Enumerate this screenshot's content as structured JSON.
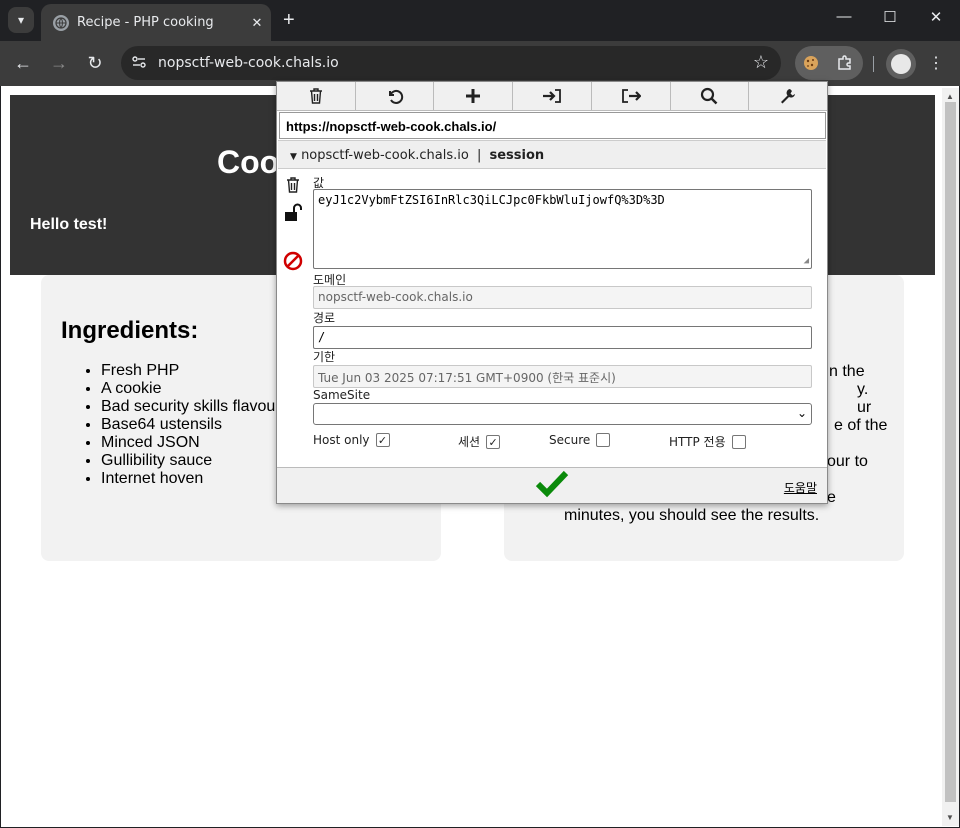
{
  "browser": {
    "tab_title": "Recipe - PHP cooking",
    "url": "nopsctf-web-cook.chals.io"
  },
  "page": {
    "hero_title": "Coo",
    "hello": "Hello test!",
    "ingredients_heading": "Ingredients:",
    "ingredients": [
      "Fresh PHP",
      "A cookie",
      "Bad security skills flavour",
      "Base64 ustensils",
      "Minced JSON",
      "Gullibility sauce",
      "Internet hoven"
    ],
    "right_fragments": [
      "n the",
      "y.",
      "ur",
      "e of the",
      "our to",
      "e",
      "minutes, you should see the results."
    ]
  },
  "cookie_editor": {
    "url": "https://nopsctf-web-cook.chals.io/",
    "domain_header": "nopsctf-web-cook.chals.io",
    "separator": "|",
    "cookie_name": "session",
    "value_label": "값",
    "value": "eyJ1c2VybmFtZSI6InRlc3QiLCJpc0FkbWluIjowfQ%3D%3D",
    "domain_label": "도메인",
    "domain": "nopsctf-web-cook.chals.io",
    "path_label": "경로",
    "path": "/",
    "expires_label": "기한",
    "expires": "Tue Jun 03 2025 07:17:51 GMT+0900 (한국 표준시)",
    "samesite_label": "SameSite",
    "samesite": "",
    "hostonly_label": "Host only",
    "session_label": "세션",
    "secure_label": "Secure",
    "httponly_label": "HTTP 전용",
    "help": "도움말",
    "checks": {
      "hostonly": true,
      "session": true,
      "secure": false,
      "httponly": false
    }
  },
  "icons": [
    "globe-icon",
    "close-icon",
    "plus-icon",
    "back-icon",
    "forward-icon",
    "reload-icon",
    "site-info-icon",
    "star-icon",
    "cookie-icon",
    "puzzle-icon",
    "menu-icon",
    "trash-icon",
    "undo-icon",
    "import-icon",
    "export-icon",
    "search-icon",
    "wrench-icon",
    "unlock-icon",
    "block-icon",
    "check-icon"
  ]
}
